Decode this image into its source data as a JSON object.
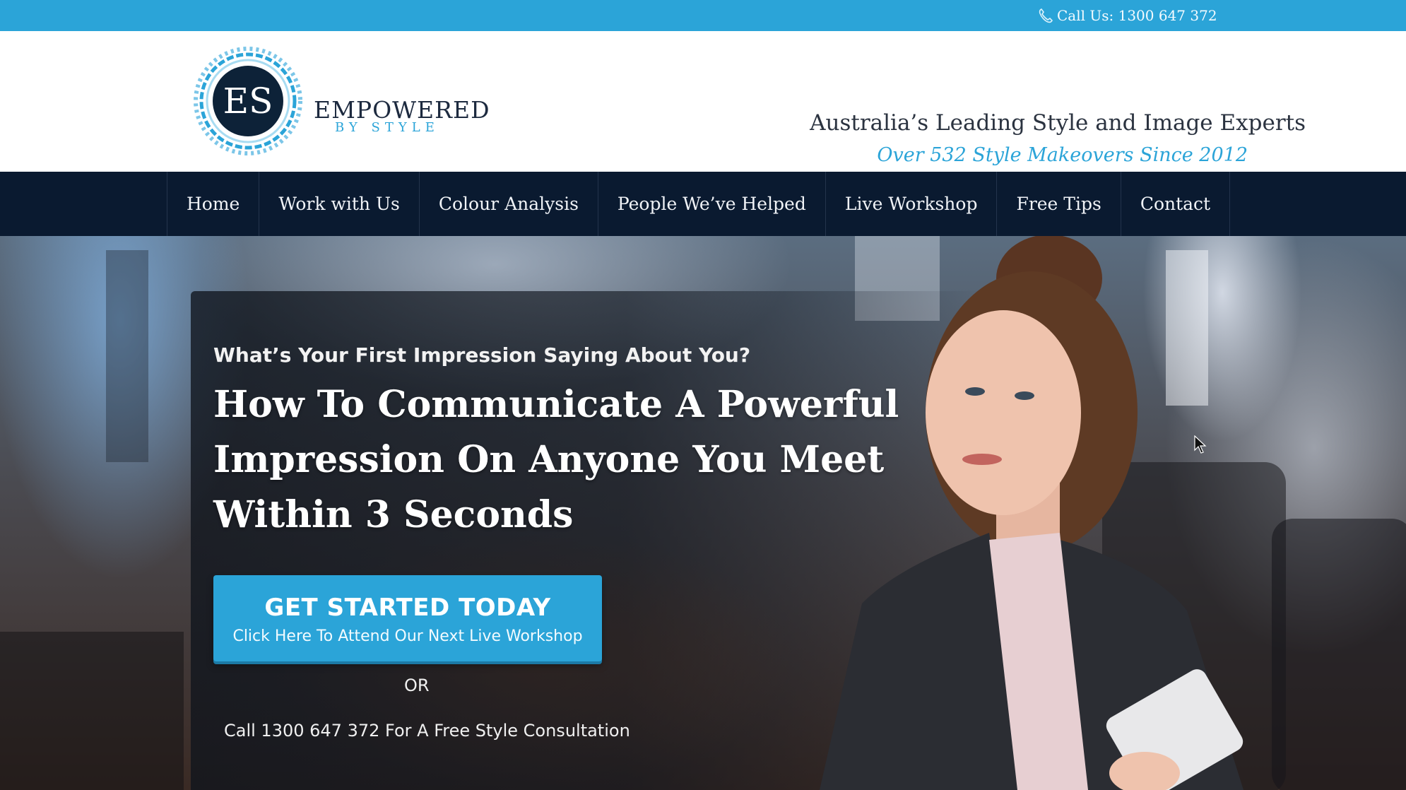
{
  "topbar": {
    "call_text": "Call Us: 1300 647 372",
    "icon": "phone-icon"
  },
  "header": {
    "logo": {
      "monogram": "ES",
      "wordmark": "EMPOWERED",
      "submark": "BY STYLE"
    },
    "tagline": "Australia’s Leading Style and Image Experts",
    "subtagline": "Over 532 Style Makeovers Since 2012"
  },
  "nav": {
    "items": [
      {
        "label": "Home"
      },
      {
        "label": "Work with Us"
      },
      {
        "label": "Colour Analysis"
      },
      {
        "label": "People We’ve Helped"
      },
      {
        "label": "Live Workshop"
      },
      {
        "label": "Free Tips"
      },
      {
        "label": "Contact"
      }
    ]
  },
  "hero": {
    "kicker": "What’s Your First Impression Saying About You?",
    "title": "How To Communicate A Powerful Impression On Anyone You Meet Within 3 Seconds",
    "cta": {
      "main": "GET STARTED TODAY",
      "sub": "Click Here To Attend Our Next Live Workshop"
    },
    "or": "OR",
    "consult": "Call 1300 647 372 For A Free Style Consultation"
  },
  "colors": {
    "accent": "#2ba4d8",
    "nav_bg": "#0a1a30",
    "header_bg": "#ffffff"
  }
}
